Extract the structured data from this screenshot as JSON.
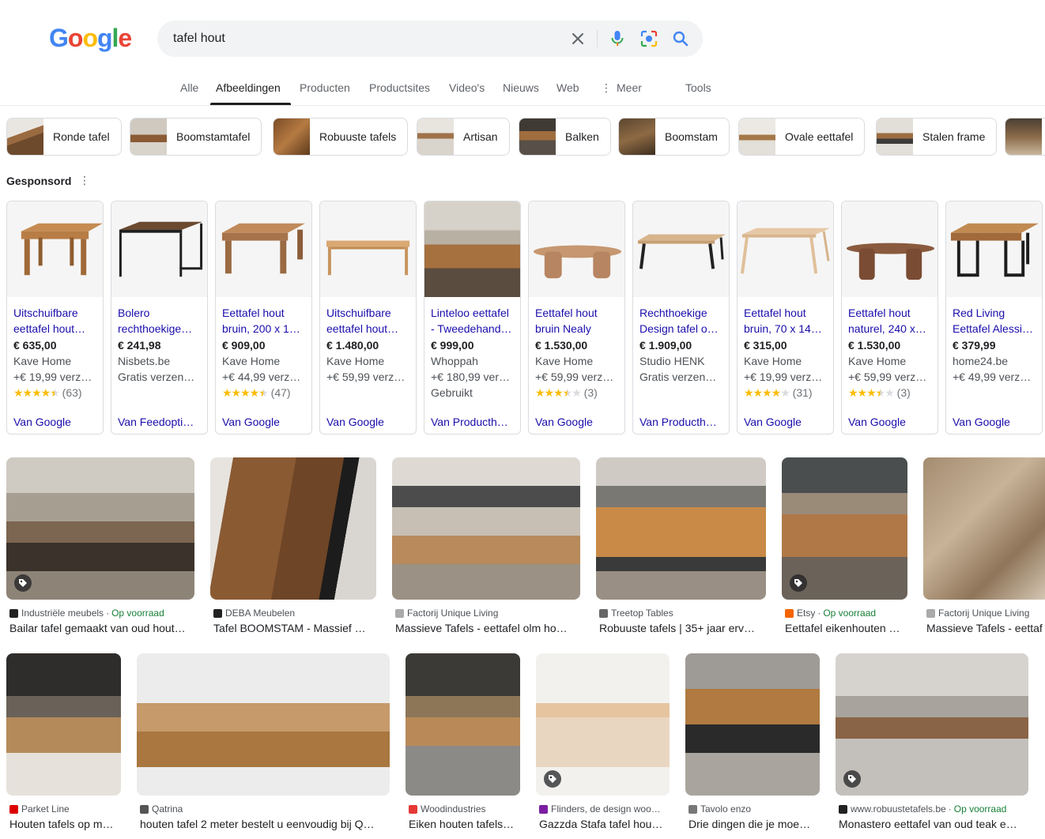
{
  "search": {
    "query": "tafel hout"
  },
  "tabs": [
    "Alle",
    "Afbeeldingen",
    "Producten",
    "Productsites",
    "Video's",
    "Nieuws",
    "Web",
    "Meer",
    "Tools"
  ],
  "chips": [
    "Ronde tafel",
    "Boomstamtafel",
    "Robuuste tafels",
    "Artisan",
    "Balken",
    "Boomstam",
    "Ovale eettafel",
    "Stalen frame"
  ],
  "sponsored_label": "Gesponsord",
  "products": [
    {
      "title": "Uitschuifbare eettafel hout…",
      "price": "€ 635,00",
      "seller": "Kave Home",
      "ship": "+€ 19,99 verz…",
      "stars": 4.5,
      "reviews": "(63)",
      "source": "Van Google"
    },
    {
      "title": "Bolero rechthoekige…",
      "price": "€ 241,98",
      "seller": "Nisbets.be",
      "ship": "Gratis verzen…",
      "stars": 0,
      "reviews": "",
      "source": "Van Feedopti…"
    },
    {
      "title": "Eettafel hout bruin, 200 x 1…",
      "price": "€ 909,00",
      "seller": "Kave Home",
      "ship": "+€ 44,99 verz…",
      "stars": 4.5,
      "reviews": "(47)",
      "source": "Van Google"
    },
    {
      "title": "Uitschuifbare eettafel hout…",
      "price": "€ 1.480,00",
      "seller": "Kave Home",
      "ship": "+€ 59,99 verz…",
      "stars": 0,
      "reviews": "",
      "source": "Van Google"
    },
    {
      "title": "Linteloo eettafel - Tweedehand…",
      "price": "€ 999,00",
      "seller": "Whoppah",
      "ship": "+€ 180,99 ver…",
      "extra": "Gebruikt",
      "stars": 0,
      "reviews": "",
      "source": "Van Producth…"
    },
    {
      "title": "Eettafel hout bruin Nealy",
      "price": "€ 1.530,00",
      "seller": "Kave Home",
      "ship": "+€ 59,99 verz…",
      "stars": 3.5,
      "reviews": "(3)",
      "source": "Van Google"
    },
    {
      "title": "Rechthoekige Design tafel o…",
      "price": "€ 1.909,00",
      "seller": "Studio HENK",
      "ship": "Gratis verzen…",
      "stars": 0,
      "reviews": "",
      "source": "Van Producth…"
    },
    {
      "title": "Eettafel hout bruin, 70 x 14…",
      "price": "€ 315,00",
      "seller": "Kave Home",
      "ship": "+€ 19,99 verz…",
      "stars": 4,
      "reviews": "(31)",
      "source": "Van Google"
    },
    {
      "title": "Eettafel hout naturel, 240 x…",
      "price": "€ 1.530,00",
      "seller": "Kave Home",
      "ship": "+€ 59,99 verz…",
      "stars": 3.5,
      "reviews": "(3)",
      "source": "Van Google"
    },
    {
      "title": "Red Living Eettafel Alessi…",
      "price": "€ 379,99",
      "seller": "home24.be",
      "ship": "+€ 49,99 verz…",
      "stars": 0,
      "reviews": "",
      "source": "Van Google"
    }
  ],
  "results_row1": [
    {
      "source": "Industriële meubels",
      "stock": "Op voorraad",
      "title": "Bailar tafel gemaakt van oud hout…",
      "tag": true
    },
    {
      "source": "DEBA Meubelen",
      "stock": "",
      "title": "Tafel BOOMSTAM - Massief …",
      "tag": false
    },
    {
      "source": "Factorij Unique Living",
      "stock": "",
      "title": "Massieve Tafels - eettafel olm ho…",
      "tag": false
    },
    {
      "source": "Treetop Tables",
      "stock": "",
      "title": "Robuuste tafels | 35+ jaar erv…",
      "tag": false
    },
    {
      "source": "Etsy",
      "stock": "Op voorraad",
      "title": "Eettafel eikenhouten …",
      "tag": true
    },
    {
      "source": "Factorij Unique Living",
      "stock": "",
      "title": "Massieve Tafels - eettaf",
      "tag": false
    }
  ],
  "results_row2": [
    {
      "source": "Parket Line",
      "stock": "",
      "title": "Houten tafels op m…",
      "tag": false
    },
    {
      "source": "Qatrina",
      "stock": "",
      "title": "houten tafel 2 meter bestelt u eenvoudig bij Q…",
      "tag": false
    },
    {
      "source": "Woodindustries",
      "stock": "",
      "title": "Eiken houten tafels…",
      "tag": false
    },
    {
      "source": "Flinders, de design woo…",
      "stock": "",
      "title": "Gazzda Stafa tafel hou…",
      "tag": true
    },
    {
      "source": "Tavolo enzo",
      "stock": "",
      "title": "Drie dingen die je moe…",
      "tag": false
    },
    {
      "source": "www.robuustetafels.be",
      "stock": "Op voorraad",
      "title": "Monastero eettafel van oud teak e…",
      "tag": true
    }
  ],
  "colors": {
    "link": "#1a0dab",
    "stock": "#188038",
    "star": "#fbbc04"
  }
}
